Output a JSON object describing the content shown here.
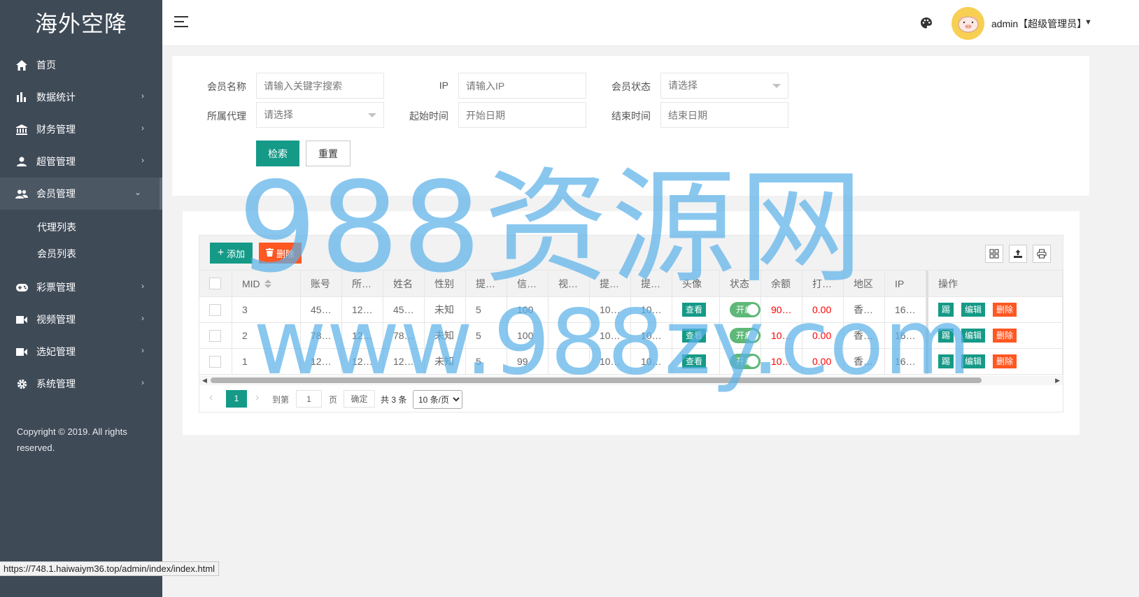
{
  "sidebar": {
    "brand": "海外空降",
    "items": [
      {
        "label": "首页",
        "icon": "home-icon"
      },
      {
        "label": "数据统计",
        "icon": "bar-chart-icon"
      },
      {
        "label": "财务管理",
        "icon": "bank-icon"
      },
      {
        "label": "超管管理",
        "icon": "user-icon"
      },
      {
        "label": "会员管理",
        "icon": "users-icon"
      },
      {
        "label": "彩票管理",
        "icon": "gamepad-icon"
      },
      {
        "label": "视频管理",
        "icon": "video-icon"
      },
      {
        "label": "选妃管理",
        "icon": "video-icon"
      },
      {
        "label": "系统管理",
        "icon": "gear-icon"
      }
    ],
    "sub_items": [
      "代理列表",
      "会员列表"
    ],
    "copyright": "Copyright © 2019. All rights reserved."
  },
  "header": {
    "user": "admin【超级管理员】",
    "avatar": "pig-avatar"
  },
  "search": {
    "member_name_label": "会员名称",
    "member_name_placeholder": "请输入关键字搜索",
    "ip_label": "IP",
    "ip_placeholder": "请输入IP",
    "status_label": "会员状态",
    "status_value": "请选择",
    "agent_label": "所属代理",
    "agent_value": "请选择",
    "start_label": "起始时间",
    "start_placeholder": "开始日期",
    "end_label": "结束时间",
    "end_placeholder": "结束日期",
    "search_button": "检索",
    "reset_button": "重置"
  },
  "toolbar": {
    "add_label": "添加",
    "delete_label": "删除"
  },
  "table": {
    "headers": [
      "MID",
      "账号",
      "所…",
      "姓名",
      "性别",
      "提…",
      "信…",
      "视…",
      "提…",
      "提…",
      "头像",
      "状态",
      "余额",
      "打…",
      "地区",
      "IP",
      "操作"
    ],
    "rows": [
      {
        "mid": "3",
        "account": "45…",
        "agent": "12…",
        "name": "45…",
        "gender": "未知",
        "c6": "5",
        "credit": "100",
        "c8": "",
        "c9": "10…",
        "c10": "10…",
        "avatar": "查看",
        "status": "开启",
        "balance": "90…",
        "c14": "0.00",
        "region": "香…",
        "ip": "16…"
      },
      {
        "mid": "2",
        "account": "78…",
        "agent": "12…",
        "name": "78…",
        "gender": "未知",
        "c6": "5",
        "credit": "100",
        "c8": "",
        "c9": "10…",
        "c10": "10…",
        "avatar": "查看",
        "status": "开启",
        "balance": "10…",
        "c14": "0.00",
        "region": "香…",
        "ip": "16…"
      },
      {
        "mid": "1",
        "account": "12…",
        "agent": "12…",
        "name": "12…",
        "gender": "未知",
        "c6": "5",
        "credit": "99",
        "c8": "",
        "c9": "10…",
        "c10": "10…",
        "avatar": "查看",
        "status": "开启",
        "balance": "10…",
        "c14": "0.00",
        "region": "香…",
        "ip": "16…"
      }
    ],
    "actions": [
      "踢",
      "编辑",
      "删除"
    ]
  },
  "pager": {
    "current": "1",
    "goto": "到第",
    "page_input": "1",
    "page_unit": "页",
    "confirm": "确定",
    "total": "共 3 条",
    "page_size": "10 条/页"
  },
  "watermark": {
    "line1": "988资源网",
    "line2": "www.988zy.com"
  },
  "statusbar": "https://748.1.haiwaiym36.top/admin/index/index.html",
  "colors": {
    "sidebar": "#3f4a57",
    "primary": "#159a87",
    "danger": "#ff5722",
    "switch_on": "#5fb878",
    "watermark": "#5bb2e9"
  }
}
